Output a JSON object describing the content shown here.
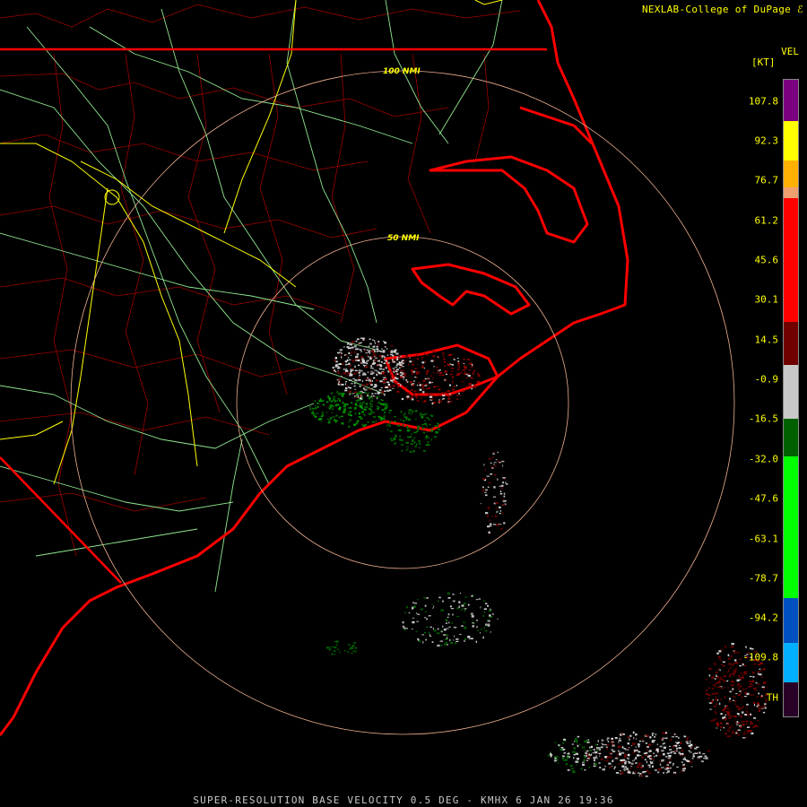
{
  "header": {
    "credit": "NEXLAB-College of DuPage"
  },
  "footer": {
    "product_line": "SUPER-RESOLUTION BASE VELOCITY 0.5 DEG - KMHX 6 JAN 26 19:36"
  },
  "legend": {
    "title": "VEL",
    "unit": "[KT]",
    "labels": [
      "107.8",
      "92.3",
      "76.7",
      "61.2",
      "45.6",
      "30.1",
      "14.5",
      "-0.9",
      "-16.5",
      "-32.0",
      "-47.6",
      "-63.1",
      "-78.7",
      "-94.2",
      "-109.8",
      "TH"
    ],
    "colors": {
      "purple": "#7a0080",
      "yellow": "#ffff00",
      "peach": "#f0a070",
      "red": "#ff0000",
      "dark_red": "#700000",
      "gray": "#c8c8c8",
      "dark_green": "#006000",
      "green": "#00ff00",
      "blue": "#0050c0",
      "cyan": "#00b0ff"
    }
  },
  "map": {
    "radar_site": "KMHX",
    "rings": [
      {
        "label": "50 NMI"
      },
      {
        "label": "100 NMI"
      }
    ],
    "colors": {
      "state_lines": "#ff0000",
      "county_lines": "#b00000",
      "highways": "#ffff00",
      "roads": "#90e890",
      "rings": "#f0b090"
    }
  }
}
